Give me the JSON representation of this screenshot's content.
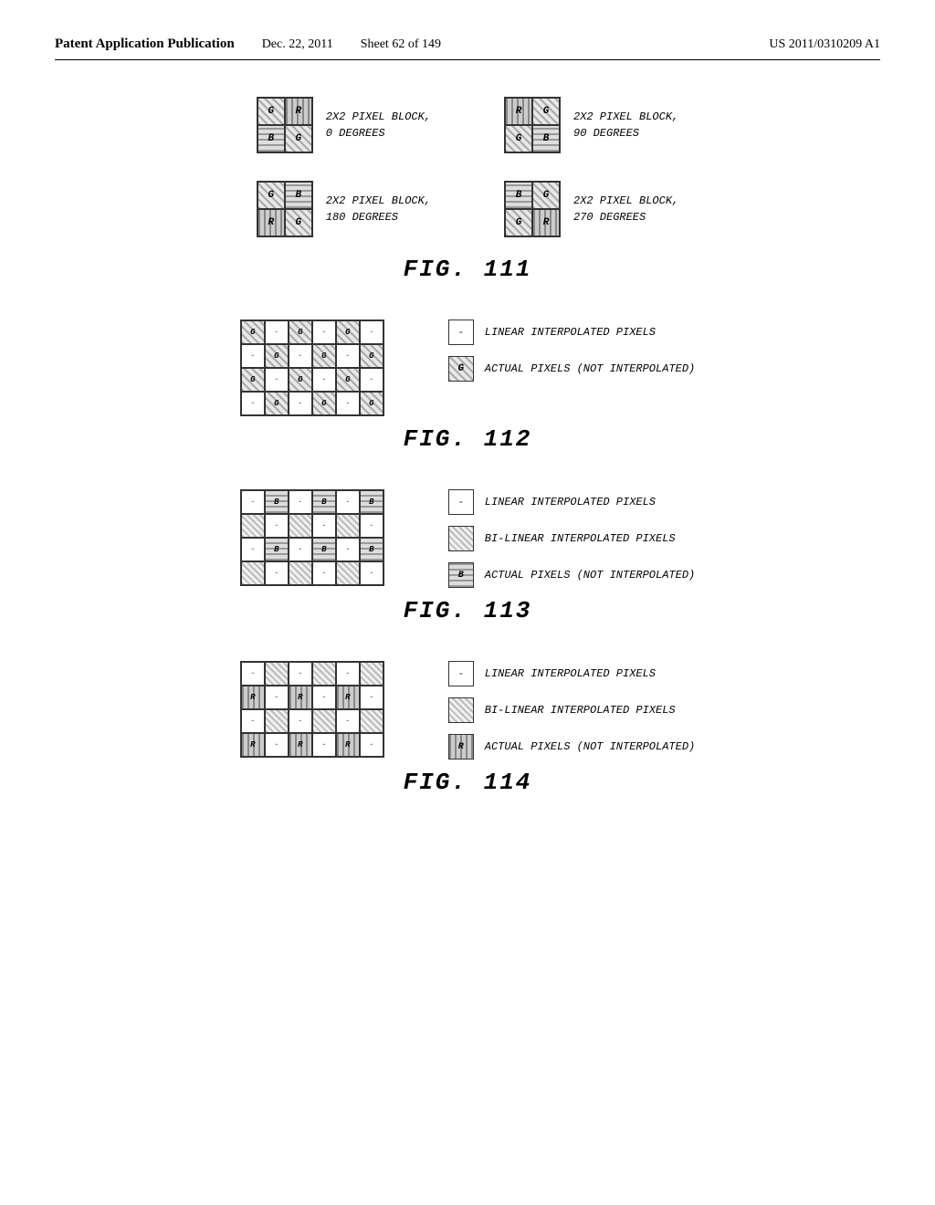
{
  "header": {
    "patent_label": "Patent Application Publication",
    "date": "Dec. 22, 2011",
    "sheet": "Sheet 62 of 149",
    "number": "US 2011/0310209 A1"
  },
  "fig111": {
    "label": "FIG. 111",
    "blocks": [
      {
        "label": "2X2 PIXEL BLOCK,\n0 DEGREES",
        "rotation": 0
      },
      {
        "label": "2X2 PIXEL BLOCK,\n90 DEGREES",
        "rotation": 90
      },
      {
        "label": "2X2 PIXEL BLOCK,\n180 DEGREES",
        "rotation": 180
      },
      {
        "label": "2X2 PIXEL BLOCK,\n270 DEGREES",
        "rotation": 270
      }
    ]
  },
  "fig112": {
    "label": "FIG. 112",
    "legend": [
      {
        "text": "LINEAR INTERPOLATED PIXELS"
      },
      {
        "text": "ACTUAL PIXELS (NOT INTERPOLATED)"
      }
    ]
  },
  "fig113": {
    "label": "FIG. 113",
    "legend": [
      {
        "text": "LINEAR INTERPOLATED PIXELS"
      },
      {
        "text": "BI-LINEAR INTERPOLATED PIXELS"
      },
      {
        "text": "ACTUAL PIXELS (NOT INTERPOLATED)"
      }
    ]
  },
  "fig114": {
    "label": "FIG. 114",
    "legend": [
      {
        "text": "LINEAR INTERPOLATED PIXELS"
      },
      {
        "text": "BI-LINEAR INTERPOLATED PIXELS"
      },
      {
        "text": "ACTUAL PIXELS (NOT INTERPOLATED)"
      }
    ]
  }
}
